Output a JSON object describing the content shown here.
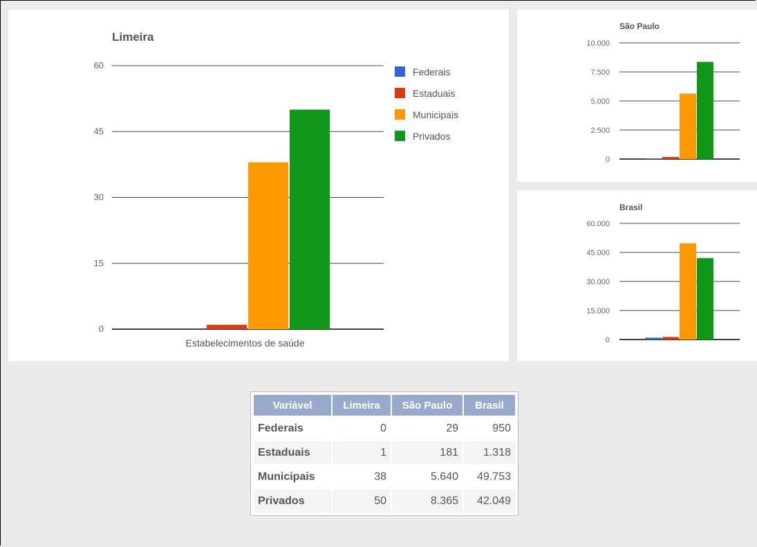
{
  "chart_data": [
    {
      "type": "bar",
      "title": "Limeira",
      "categories": [
        "Estabelecimentos de saúde"
      ],
      "series": [
        {
          "name": "Federais",
          "values": [
            0
          ],
          "color": "#3366cc"
        },
        {
          "name": "Estaduais",
          "values": [
            1
          ],
          "color": "#dc3912"
        },
        {
          "name": "Municipais",
          "values": [
            38
          ],
          "color": "#ff9900"
        },
        {
          "name": "Privados",
          "values": [
            50
          ],
          "color": "#109618"
        }
      ],
      "yticks": [
        "0",
        "15",
        "30",
        "45",
        "60"
      ],
      "ylim": [
        0,
        60
      ],
      "legend": "right",
      "grid": true
    },
    {
      "type": "bar",
      "title": "São Paulo",
      "categories": [
        ""
      ],
      "series": [
        {
          "name": "Federais",
          "values": [
            29
          ],
          "color": "#3366cc"
        },
        {
          "name": "Estaduais",
          "values": [
            181
          ],
          "color": "#dc3912"
        },
        {
          "name": "Municipais",
          "values": [
            5640
          ],
          "color": "#ff9900"
        },
        {
          "name": "Privados",
          "values": [
            8365
          ],
          "color": "#109618"
        }
      ],
      "yticks": [
        "0",
        "2.500",
        "5.000",
        "7.500",
        "10.000"
      ],
      "ylim": [
        0,
        10000
      ],
      "grid": true
    },
    {
      "type": "bar",
      "title": "Brasil",
      "categories": [
        ""
      ],
      "series": [
        {
          "name": "Federais",
          "values": [
            950
          ],
          "color": "#3366cc"
        },
        {
          "name": "Estaduais",
          "values": [
            1318
          ],
          "color": "#dc3912"
        },
        {
          "name": "Municipais",
          "values": [
            49753
          ],
          "color": "#ff9900"
        },
        {
          "name": "Privados",
          "values": [
            42049
          ],
          "color": "#109618"
        }
      ],
      "yticks": [
        "0",
        "15.000",
        "30.000",
        "45.000",
        "60.000"
      ],
      "ylim": [
        0,
        60000
      ],
      "grid": true
    }
  ],
  "table": {
    "headers": [
      "Variável",
      "Limeira",
      "São Paulo",
      "Brasil"
    ],
    "rows": [
      [
        "Federais",
        "0",
        "29",
        "950"
      ],
      [
        "Estaduais",
        "1",
        "181",
        "1.318"
      ],
      [
        "Municipais",
        "38",
        "5.640",
        "49.753"
      ],
      [
        "Privados",
        "50",
        "8.365",
        "42.049"
      ]
    ]
  }
}
